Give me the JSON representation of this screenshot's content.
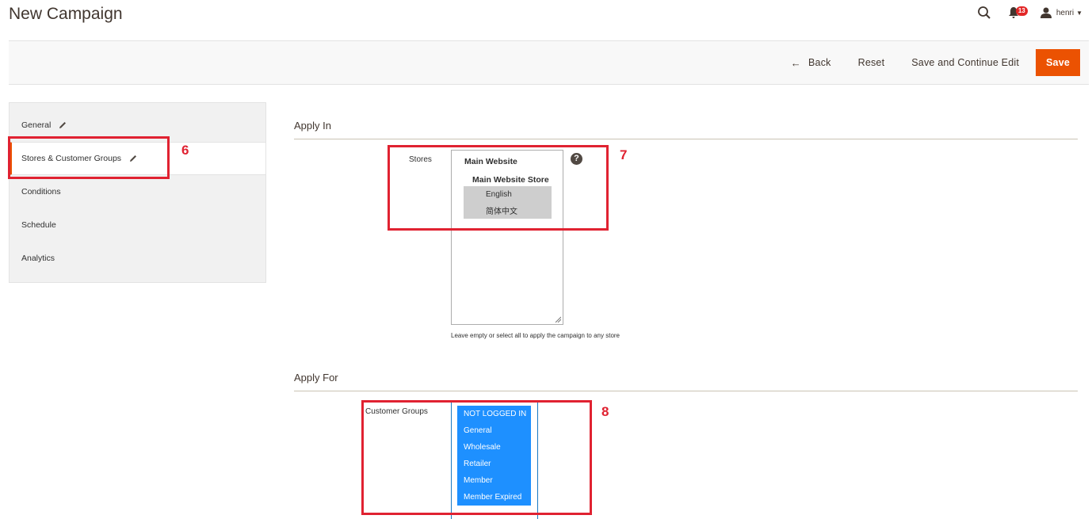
{
  "page": {
    "title": "New Campaign"
  },
  "header": {
    "notification_count": "13",
    "user_name": "henri"
  },
  "toolbar": {
    "back_label": "Back",
    "reset_label": "Reset",
    "save_continue_label": "Save and Continue Edit",
    "save_label": "Save"
  },
  "sidebar": {
    "items": [
      {
        "label": "General"
      },
      {
        "label": "Stores & Customer Groups"
      },
      {
        "label": "Conditions"
      },
      {
        "label": "Schedule"
      },
      {
        "label": "Analytics"
      }
    ]
  },
  "apply_in": {
    "title": "Apply In",
    "stores_label": "Stores",
    "website": "Main Website",
    "store": "Main Website Store",
    "views": [
      "English",
      "简体中文"
    ],
    "help": "?",
    "note": "Leave empty or select all to apply the campaign to any store"
  },
  "apply_for": {
    "title": "Apply For",
    "groups_label": "Customer Groups",
    "groups": [
      "NOT LOGGED IN",
      "General",
      "Wholesale",
      "Retailer",
      "Member",
      "Member Expired"
    ]
  },
  "annotations": [
    "6",
    "7",
    "8"
  ],
  "colors": {
    "accent": "#eb5202",
    "selected_option": "#1e90ff",
    "annotation": "#e02231"
  }
}
